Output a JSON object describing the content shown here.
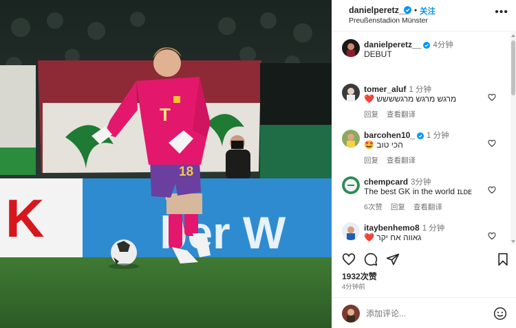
{
  "post": {
    "username": "danielperetz__",
    "follow_label": "关注",
    "separator": "•",
    "location": "Preußenstadion Münster",
    "more_icon": "more-horizontal-icon"
  },
  "photo": {
    "jersey_number": "18",
    "banner_letters": [
      "K",
      "ber W"
    ]
  },
  "caption": {
    "username": "danielperetz__",
    "time": "4分钟",
    "text": "DEBUT"
  },
  "comments": [
    {
      "username": "tomer_aluf",
      "time": "1 分钟",
      "text": "מרגש מרגש מרגשששש",
      "emoji": "❤️",
      "actions": [
        "回复",
        "查看翻译"
      ]
    },
    {
      "username": "barcohen10_",
      "time": "1 分钟",
      "text": "הכי טוב",
      "emoji": "🤩",
      "actions": [
        "回复",
        "查看翻译"
      ]
    },
    {
      "username": "chempcard",
      "time": "3分钟",
      "text": "The best GK in the world ɪʟᴅᴇ",
      "actions": [
        "6次赞",
        "回复",
        "查看翻译"
      ]
    },
    {
      "username": "itaybenhemo8",
      "time": "1 分钟",
      "text": "גאווה אח יקר",
      "emoji": "❤️"
    }
  ],
  "actionbar": {
    "icons": [
      "heart-icon",
      "comment-icon",
      "share-icon",
      "bookmark-icon"
    ]
  },
  "likes": "1932次赞",
  "posted_ago": "4分钟前",
  "add_comment": {
    "placeholder": "添加评论..."
  },
  "colors": {
    "accent": "#0095f6",
    "verified": "#0095f6",
    "text": "#262626",
    "muted": "#737373",
    "jersey": "#e3186c",
    "shorts": "#6b3fa0"
  }
}
